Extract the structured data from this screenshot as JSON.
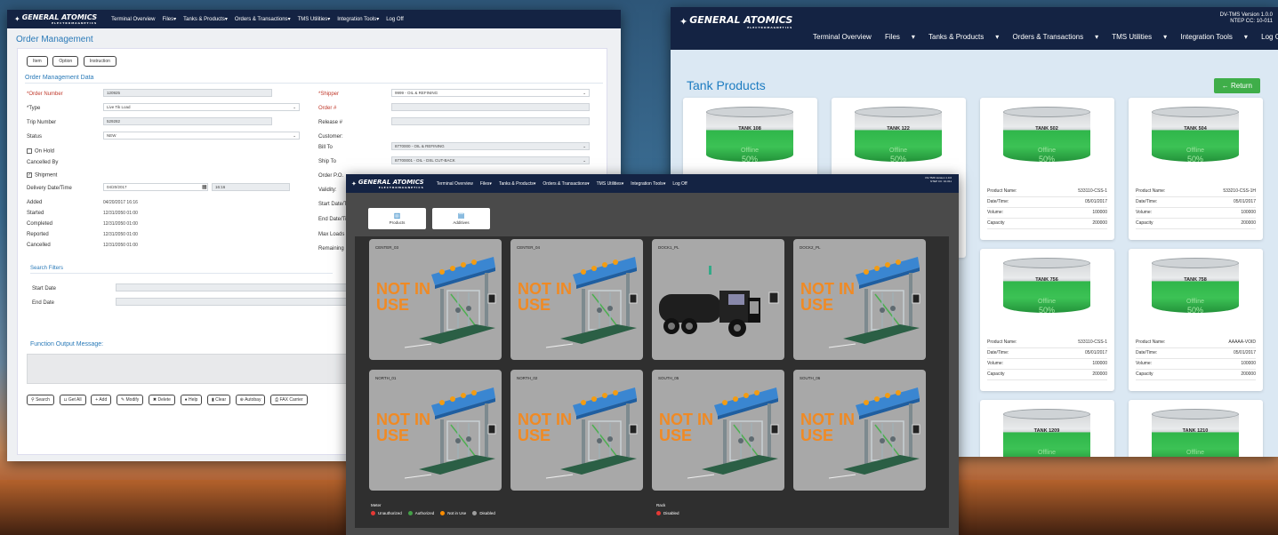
{
  "brand": {
    "name": "GENERAL ATOMICS",
    "sub": "ELECTROMAGNETICS"
  },
  "nav": [
    "Terminal Overview",
    "Files",
    "Tanks & Products",
    "Orders & Transactions",
    "TMS Utilities",
    "Integration Tools",
    "Log Off"
  ],
  "order_window": {
    "title": "Order Management",
    "buttons": [
      "Item",
      "Option",
      "Instruction"
    ],
    "section": "Order Management Data",
    "left_fields": [
      {
        "label": "*Order Number",
        "value": "120925"
      },
      {
        "label": "*Type",
        "value": "Live Tik Load"
      },
      {
        "label": "Trip Number",
        "value": "529282"
      },
      {
        "label": "Status",
        "value": "NEW"
      }
    ],
    "on_hold": "On Hold",
    "cancelled_by": "Cancelled By",
    "shipment": "Shipment",
    "delivery_label": "Delivery Date/Time",
    "delivery_date": "04/20/2017",
    "delivery_time": "16:16",
    "timestamps": [
      {
        "label": "Added",
        "value": "04/20/2017 16:16"
      },
      {
        "label": "Started",
        "value": "12/31/2050 01:00"
      },
      {
        "label": "Completed",
        "value": "12/31/2050 01:00"
      },
      {
        "label": "Reported",
        "value": "12/31/2050 01:00"
      },
      {
        "label": "Cancelled",
        "value": "12/31/2050 01:00"
      }
    ],
    "right_fields": [
      {
        "label": "*Shipper",
        "value": "9999 - OIL & REFINING"
      },
      {
        "label": "Order #",
        "value": ""
      },
      {
        "label": "Release #",
        "value": ""
      },
      {
        "label": "Customer:",
        "value": ""
      },
      {
        "label": "Bill To",
        "value": "8770000 - OIL & REFINING"
      },
      {
        "label": "Ship To",
        "value": "87700001 - OIL - DSL CUT-BACK"
      }
    ],
    "right_labels_more": [
      "Order P.O.",
      "Validity:",
      "Start Date/Tim",
      "End Date/Tim",
      "Max Loads",
      "Remaining"
    ],
    "search_filters": "Search Filters",
    "start_date": "Start Date",
    "end_date": "End Date",
    "function_output": "Function Output Message:",
    "bottom_buttons": [
      "Search",
      "Get All",
      "Add",
      "Modify",
      "Delete",
      "Help",
      "Clear",
      "Autobay",
      "FAX Carrier"
    ]
  },
  "tank_window": {
    "version_line1": "DV-TMS Version 1.0.0",
    "version_line2": "NTEP CC: 10-011",
    "title": "Tank Products",
    "return_label": "Return",
    "tanks": [
      {
        "name": "TANK 108",
        "status": "Offline",
        "percent": "50%"
      },
      {
        "name": "TANK 122",
        "status": "Offline",
        "percent": "50%"
      },
      {
        "name": "TANK 502",
        "status": "Offline",
        "percent": "50%",
        "product": "533110-CSS-1",
        "date": "05/01/2017",
        "volume": "100000",
        "capacity": "200000"
      },
      {
        "name": "TANK 504",
        "status": "Offline",
        "percent": "50%",
        "product": "533210-CSS-1H",
        "date": "05/01/2017",
        "volume": "100000",
        "capacity": "200000"
      },
      {
        "name": "TANK 756",
        "status": "Offline",
        "percent": "50%",
        "product": "533110-CSS-1",
        "date": "05/01/2017",
        "volume": "100000",
        "capacity": "200000"
      },
      {
        "name": "TANK 758",
        "status": "Offline",
        "percent": "50%",
        "product": "AAAAA-VOID",
        "date": "05/01/2017",
        "volume": "100000",
        "capacity": "200000"
      },
      {
        "name": "TANK 1209",
        "status": "Offline",
        "percent": "50%"
      },
      {
        "name": "TANK 1210",
        "status": "Offline",
        "percent": "50%"
      }
    ],
    "info_labels": {
      "product": "Product Name:",
      "date": "Date/Time:",
      "volume": "Volume:",
      "capacity": "Capacity"
    }
  },
  "bay_window": {
    "version_line1": "DV-TMS Version 1.0.0",
    "version_line2": "NTEP CC: 10-011",
    "tabs": [
      "Products",
      "Additives"
    ],
    "bays": [
      {
        "name": "CENTER_03",
        "status": "NOT IN USE"
      },
      {
        "name": "CENTER_04",
        "status": "NOT IN USE"
      },
      {
        "name": "DOCK1_PL",
        "status": ""
      },
      {
        "name": "DOCK2_PL",
        "status": "NOT IN USE"
      },
      {
        "name": "NORTH_01",
        "status": "NOT IN USE"
      },
      {
        "name": "NORTH_02",
        "status": "NOT IN USE"
      },
      {
        "name": "SOUTH_05",
        "status": "NOT IN USE"
      },
      {
        "name": "SOUTH_06",
        "status": "NOT IN USE"
      }
    ],
    "meter_label": "Meter",
    "meter_legend": [
      {
        "label": "Unauthorized",
        "color": "#e53935"
      },
      {
        "label": "Authorized",
        "color": "#43a047"
      },
      {
        "label": "Not in Use",
        "color": "#fb8c00"
      },
      {
        "label": "Disabled",
        "color": "#9e9e9e"
      }
    ],
    "rack_label": "Rack",
    "rack_legend": [
      {
        "label": "Disabled",
        "color": "#e53935"
      }
    ]
  }
}
